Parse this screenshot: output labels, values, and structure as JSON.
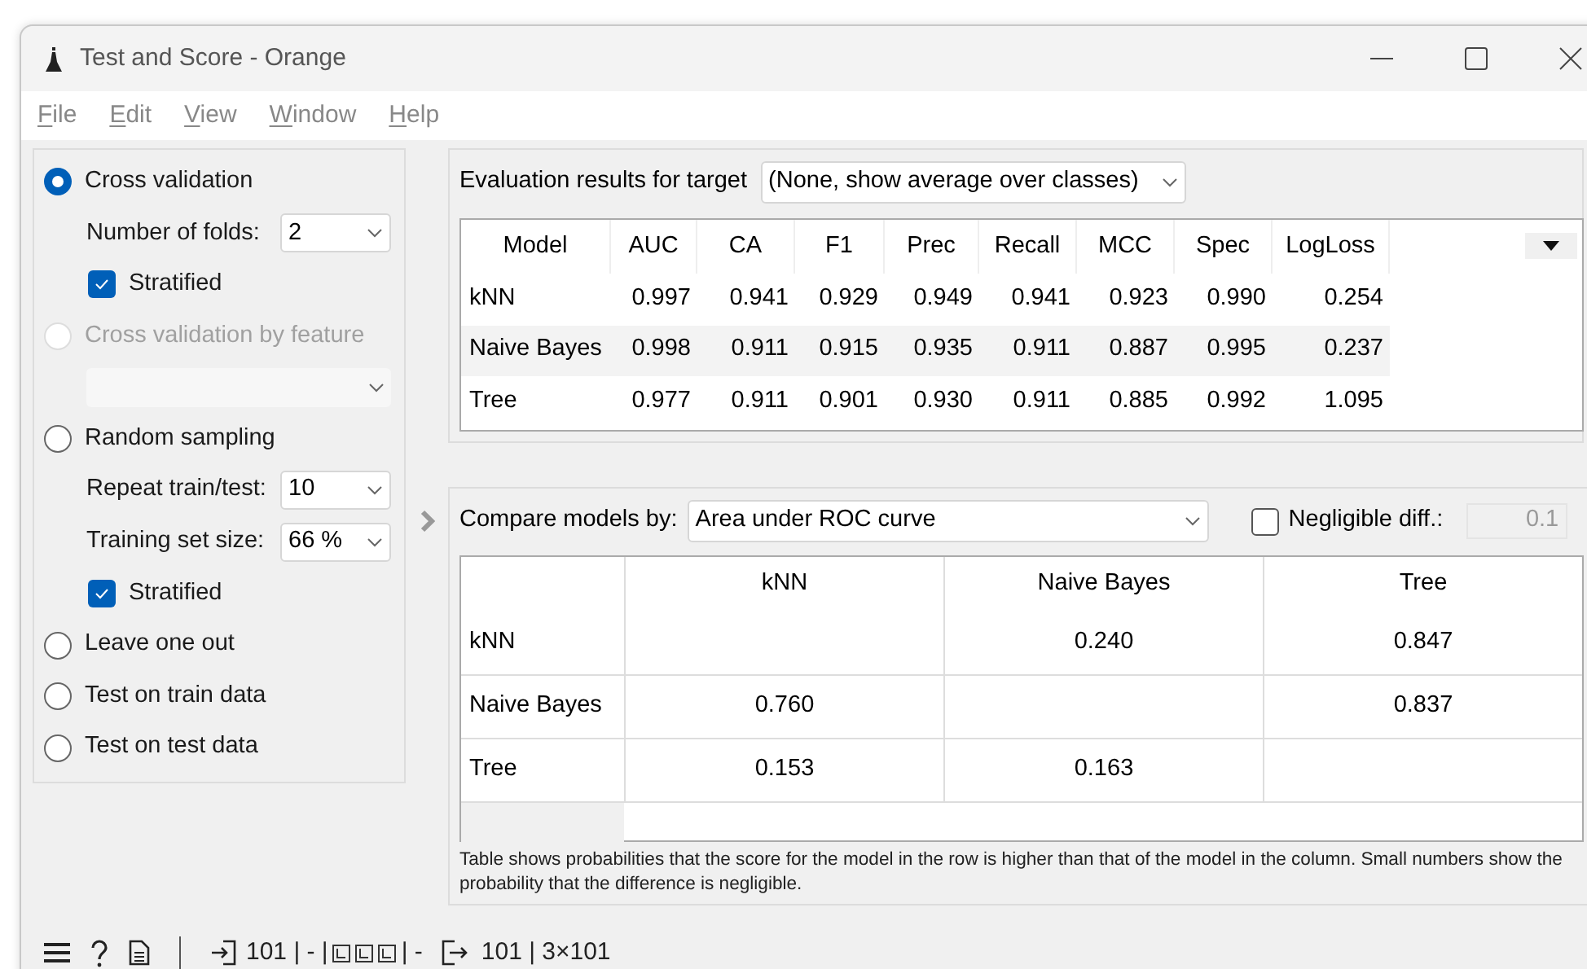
{
  "window": {
    "title": "Test and Score - Orange"
  },
  "menu": [
    "File",
    "Edit",
    "View",
    "Window",
    "Help"
  ],
  "sampling": [
    {
      "kind": "radio",
      "label": "Cross validation",
      "selected": true,
      "disabled": false
    },
    {
      "kind": "select",
      "label": "Number of folds:",
      "value": "2",
      "disabled": false
    },
    {
      "kind": "checkbox",
      "label": "Stratified",
      "checked": true
    },
    {
      "kind": "radio",
      "label": "Cross validation by feature",
      "selected": false,
      "disabled": true
    },
    {
      "kind": "select",
      "disabled": true
    },
    {
      "kind": "radio",
      "label": "Random sampling",
      "selected": false,
      "disabled": false
    },
    {
      "kind": "select",
      "label": "Repeat train/test:",
      "value": "10",
      "disabled": false
    },
    {
      "kind": "select",
      "label": "Training set size:",
      "value": "66 %",
      "disabled": false
    },
    {
      "kind": "checkbox",
      "label": "Stratified",
      "checked": true
    },
    {
      "kind": "radio",
      "label": "Leave one out",
      "selected": false,
      "disabled": false
    },
    {
      "kind": "radio",
      "label": "Test on train data",
      "selected": false,
      "disabled": false
    },
    {
      "kind": "radio",
      "label": "Test on test data",
      "selected": false,
      "disabled": false
    }
  ],
  "evaluation": {
    "target_label": "Evaluation results for target",
    "target_value": "(None, show average over classes)",
    "columns": [
      "Model",
      "AUC",
      "CA",
      "F1",
      "Prec",
      "Recall",
      "MCC",
      "Spec",
      "LogLoss"
    ],
    "rows": [
      [
        "kNN",
        "0.997",
        "0.941",
        "0.929",
        "0.949",
        "0.941",
        "0.923",
        "0.990",
        "0.254"
      ],
      [
        "Naive Bayes",
        "0.998",
        "0.911",
        "0.915",
        "0.935",
        "0.911",
        "0.887",
        "0.995",
        "0.237"
      ],
      [
        "Tree",
        "0.977",
        "0.911",
        "0.901",
        "0.930",
        "0.911",
        "0.885",
        "0.992",
        "1.095"
      ]
    ]
  },
  "comparison": {
    "compare_label": "Compare models by:",
    "compare_value": "Area under ROC curve",
    "negligible": {
      "label": "Negligible diff.:",
      "checked": false,
      "value": "0.1"
    },
    "columns": [
      "kNN",
      "Naive Bayes",
      "Tree"
    ],
    "rows": [
      {
        "name": "kNN",
        "values": {
          "1": "0.240",
          "2": "0.847"
        }
      },
      {
        "name": "Naive Bayes",
        "values": {
          "0": "0.760",
          "2": "0.837"
        }
      },
      {
        "name": "Tree",
        "values": {
          "0": "0.153",
          "1": "0.163"
        }
      }
    ],
    "note": "Table shows probabilities that the score for the model in the row is higher than that of the model in the column. Small numbers show the probability that the difference is negligible."
  },
  "status_bar": {
    "input_count": "101 | - |",
    "middle": "| -",
    "output": "101 | 3×101"
  }
}
